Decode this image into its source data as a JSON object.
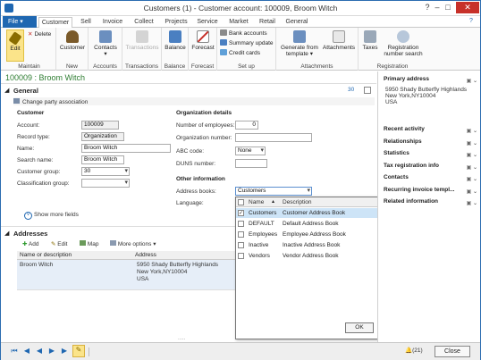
{
  "window": {
    "title": "Customers (1) - Customer account: 100009, Broom Witch"
  },
  "menu": {
    "file": "File",
    "tabs": [
      "Customer",
      "Sell",
      "Invoice",
      "Collect",
      "Projects",
      "Service",
      "Market",
      "Retail",
      "General"
    ]
  },
  "ribbon": {
    "maintain": {
      "label": "Maintain",
      "edit": "Edit",
      "delete": "Delete"
    },
    "new": {
      "label": "New",
      "customer": "Customer"
    },
    "accounts": {
      "label": "Accounts",
      "contacts": "Contacts"
    },
    "transactions": {
      "label": "Transactions",
      "transactions": "Transactions"
    },
    "balance": {
      "label": "Balance",
      "balance": "Balance"
    },
    "forecast": {
      "label": "Forecast",
      "forecast": "Forecast"
    },
    "setup": {
      "label": "Set up",
      "bank_accounts": "Bank accounts",
      "summary_update": "Summary update",
      "credit_cards": "Credit cards"
    },
    "attachments": {
      "label": "Attachments",
      "generate_template": "Generate from template",
      "attachments": "Attachments"
    },
    "registration": {
      "label": "Registration",
      "taxes": "Taxes",
      "reg_search": "Registration number search"
    }
  },
  "header": {
    "record_title": "100009 : Broom Witch"
  },
  "general": {
    "title": "General",
    "count": "30",
    "change_party": "Change party association",
    "customer_section": "Customer",
    "account_label": "Account:",
    "account_value": "100009",
    "record_type_label": "Record type:",
    "record_type_value": "Organization",
    "name_label": "Name:",
    "name_value": "Broom Witch",
    "search_name_label": "Search name:",
    "search_name_value": "Broom Witch",
    "customer_group_label": "Customer group:",
    "customer_group_value": "30",
    "classification_label": "Classification group:",
    "classification_value": "",
    "org_section": "Organization details",
    "employees_label": "Number of employees:",
    "employees_value": "0",
    "org_number_label": "Organization number:",
    "abc_label": "ABC code:",
    "abc_value": "None",
    "duns_label": "DUNS number:",
    "other_section": "Other information",
    "address_books_label": "Address books:",
    "address_books_value": "Customers",
    "language_label": "Language:",
    "show_more": "Show more fields"
  },
  "addresses": {
    "title": "Addresses",
    "add": "Add",
    "edit": "Edit",
    "map": "Map",
    "more": "More options",
    "col_name": "Name or description",
    "col_address": "Address",
    "row_name": "Broom Witch",
    "row_address_1": "5950 Shady Butterfly Highlands",
    "row_address_2": "New York,NY10004",
    "row_address_3": "USA"
  },
  "dropdown": {
    "col_name": "Name",
    "col_desc": "Description",
    "rows": [
      {
        "name": "Customers",
        "desc": "Customer Address Book",
        "checked": true
      },
      {
        "name": "DEFAULT",
        "desc": "Default Address Book",
        "checked": false
      },
      {
        "name": "Employees",
        "desc": "Employee Address Book",
        "checked": false
      },
      {
        "name": "Inactive",
        "desc": "Inactive Address Book",
        "checked": false
      },
      {
        "name": "Vendors",
        "desc": "Vendor Address Book",
        "checked": false
      }
    ],
    "ok": "OK"
  },
  "factbox": {
    "primary_title": "Primary address",
    "primary_1": "5950 Shady Butterfly Highlands",
    "primary_2": "New York,NY10004",
    "primary_3": "USA",
    "items": [
      "Recent activity",
      "Relationships",
      "Statistics",
      "Tax registration info",
      "Contacts",
      "Recurring invoice templ...",
      "Related information"
    ]
  },
  "status": {
    "count": "(21)",
    "close": "Close"
  },
  "colors": {
    "accent": "#1f67b1",
    "title_green": "#2e7d32",
    "close_red": "#c7312a"
  }
}
